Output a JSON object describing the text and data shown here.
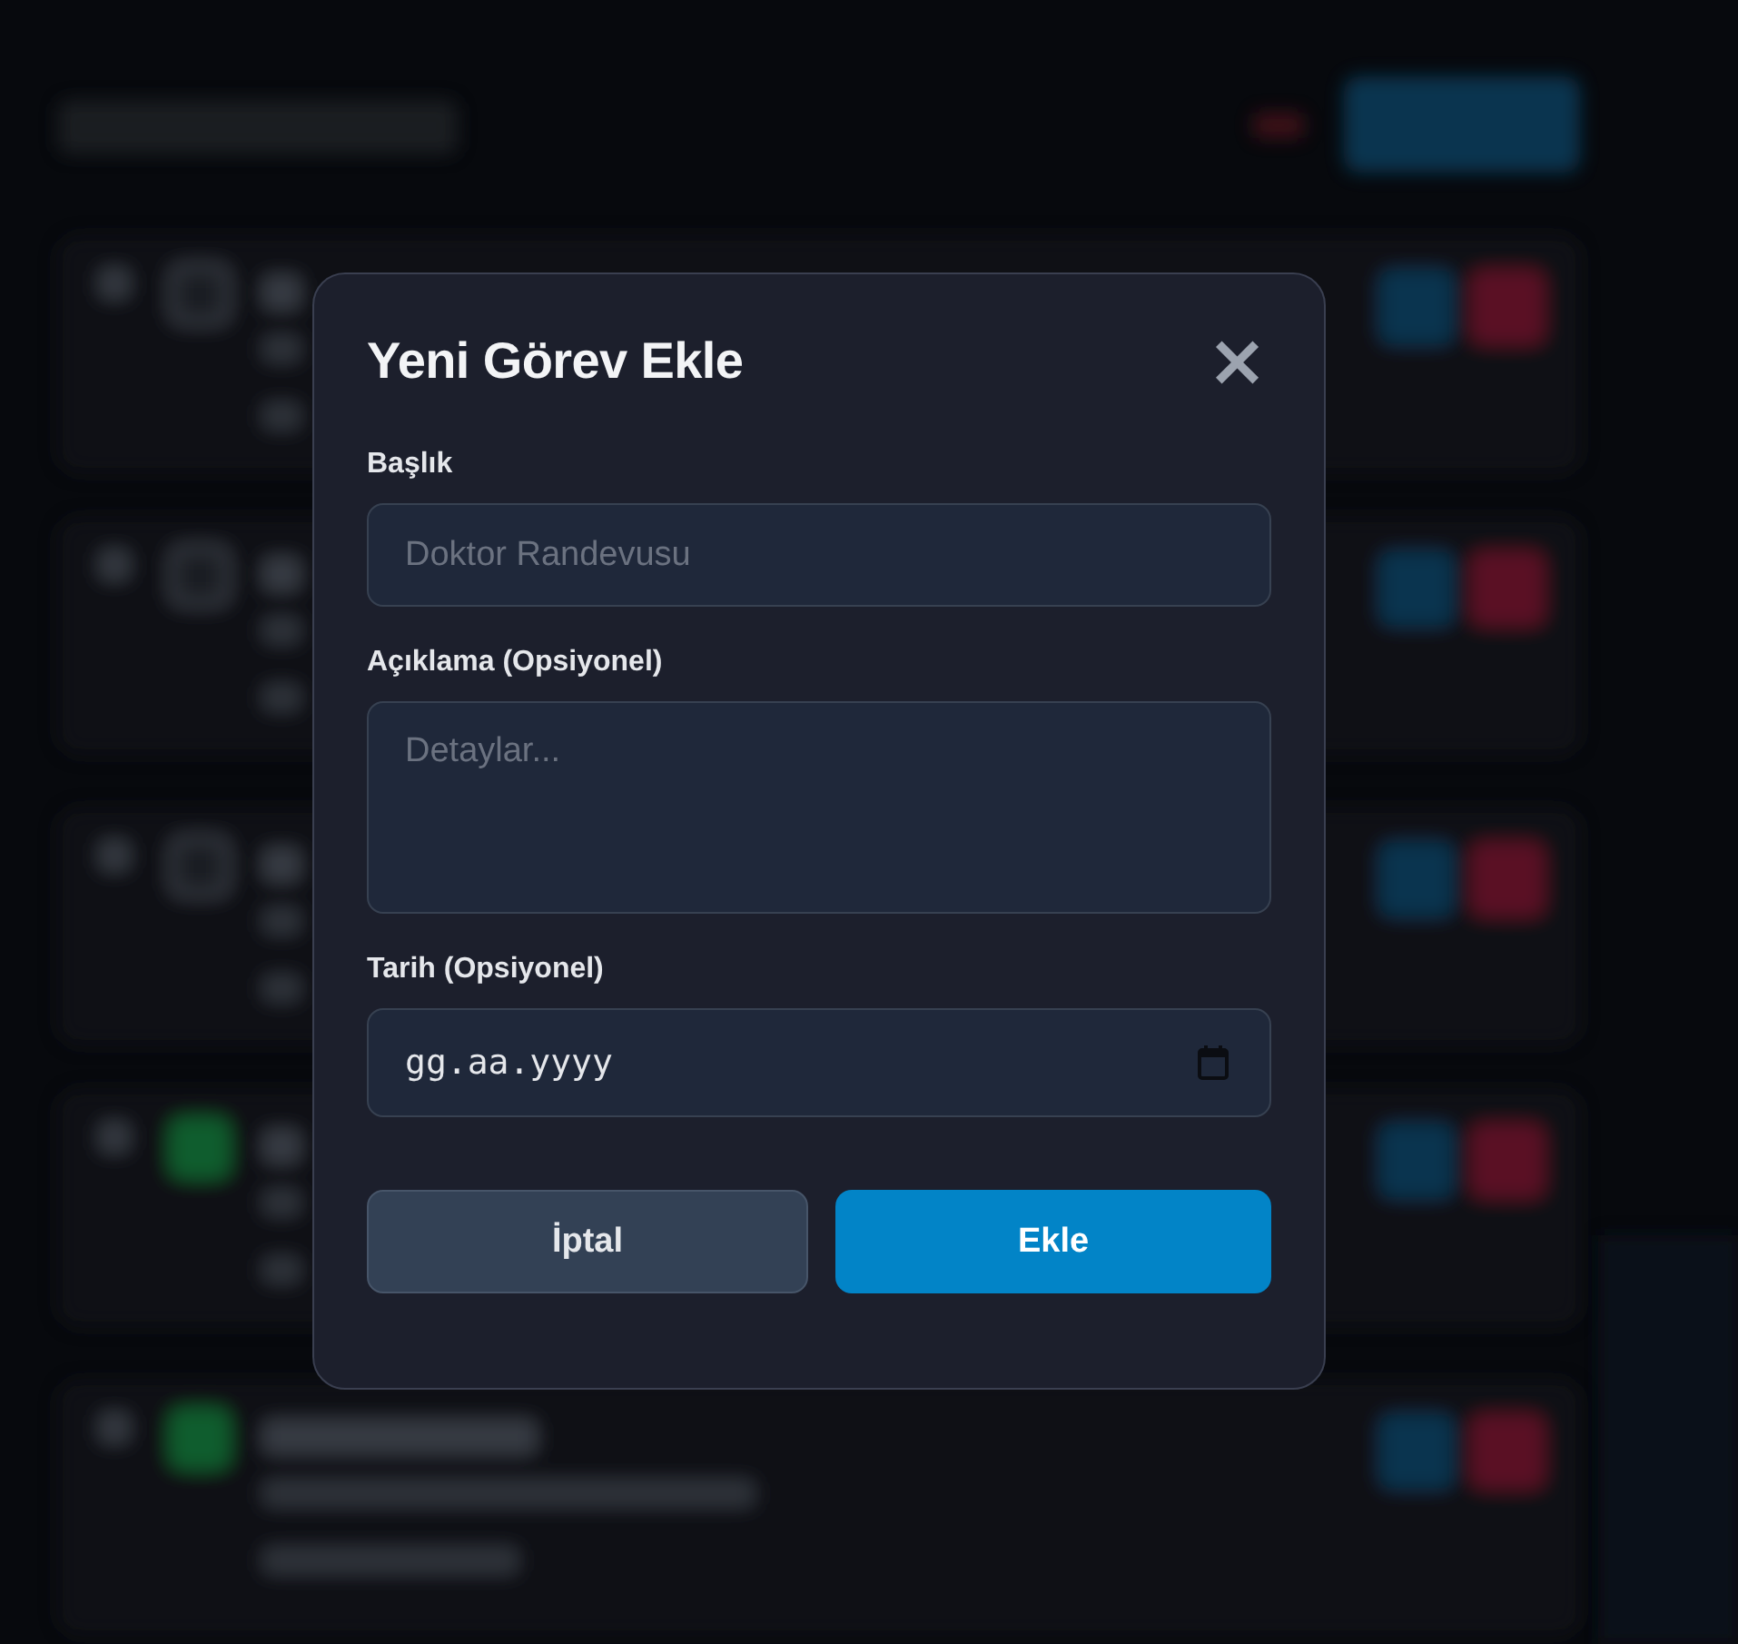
{
  "background": {
    "tasks": [
      {
        "done": false
      },
      {
        "done": false
      },
      {
        "done": false
      },
      {
        "done": true
      },
      {
        "done": true
      }
    ]
  },
  "dialog": {
    "title": "Yeni Görev Ekle",
    "close": "×",
    "fields": [
      {
        "kind": "text",
        "label": "Başlık",
        "placeholder": "Doktor Randevusu"
      },
      {
        "kind": "textarea",
        "label": "Açıklama (Opsiyonel)",
        "placeholder": "Detaylar..."
      },
      {
        "kind": "date",
        "label": "Tarih (Opsiyonel)",
        "placeholder": "gg.aa.yyyy"
      }
    ],
    "buttons": [
      {
        "label": "İptal",
        "kind": "secondary"
      },
      {
        "label": "Ekle",
        "kind": "primary"
      }
    ]
  }
}
